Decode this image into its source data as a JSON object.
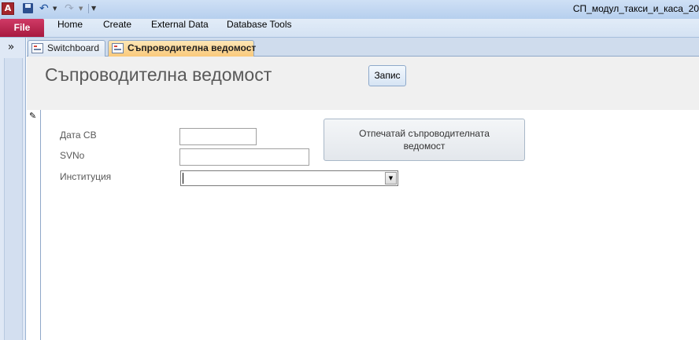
{
  "app": {
    "icon_letter": "A",
    "window_title": "СП_модул_такси_и_каса_20"
  },
  "quick_access": {
    "save_icon": "save-icon",
    "undo_icon": "undo-icon",
    "redo_icon": "redo-icon"
  },
  "ribbon": {
    "file_label": "File",
    "tabs": [
      "Home",
      "Create",
      "External Data",
      "Database Tools"
    ]
  },
  "nav_pane": {
    "toggle_glyph": "»"
  },
  "document_tabs": [
    {
      "label": "Switchboard",
      "active": false
    },
    {
      "label": "Съпроводителна ведомост",
      "active": true
    }
  ],
  "form": {
    "title": "Съпроводителна ведомост",
    "save_button_label": "Запис",
    "fields": {
      "date_label": "Дата СВ",
      "date_value": "",
      "svno_label": "SVNo",
      "svno_value": "",
      "institution_label": "Институция",
      "institution_value": ""
    },
    "print_button_line1": "Отпечатай съпроводителната",
    "print_button_line2": "ведомост"
  },
  "colors": {
    "file_tab": "#b7204a",
    "active_doc_tab": "#f9c97b",
    "form_header_bg": "#f0f0f0"
  }
}
